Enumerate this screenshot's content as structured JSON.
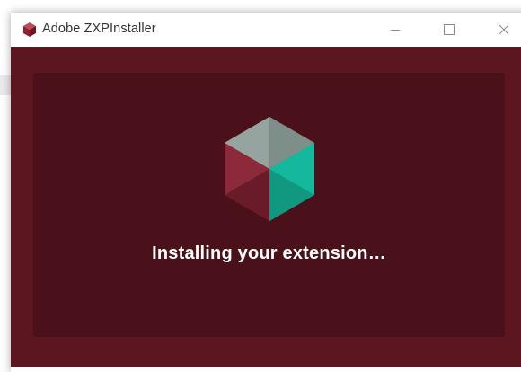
{
  "window": {
    "title": "Adobe ZXPInstaller",
    "app_icon": "zxp-cube-icon",
    "controls": {
      "minimize_icon": "minimize-icon",
      "maximize_icon": "maximize-icon",
      "close_icon": "close-icon"
    }
  },
  "main": {
    "status_text": "Installing your extension…",
    "logo_icon": "zxp-cube-logo"
  },
  "colors": {
    "background": "#5c161f",
    "panel": "#4a111a",
    "cube_top": "#8a9a94",
    "cube_left": "#7b2232",
    "cube_right": "#19a88f",
    "text": "#ffffff"
  }
}
